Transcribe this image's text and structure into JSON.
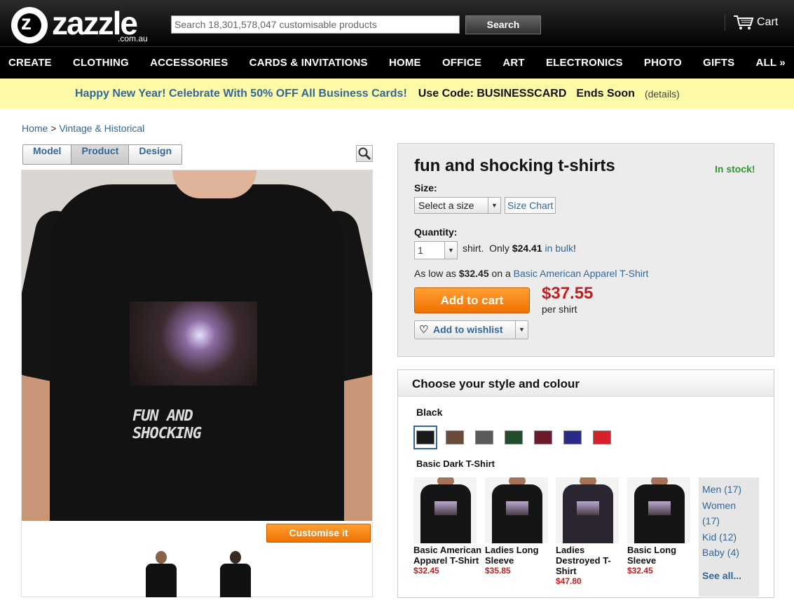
{
  "header": {
    "logo": "zazzle",
    "logo_sub": ".com.au",
    "search_placeholder": "Search 18,301,578,047 customisable products",
    "search_button": "Search",
    "cart_label": "Cart",
    "nav": [
      "CREATE",
      "CLOTHING",
      "ACCESSORIES",
      "CARDS & INVITATIONS",
      "HOME",
      "OFFICE",
      "ART",
      "ELECTRONICS",
      "PHOTO",
      "GIFTS",
      "ALL »"
    ]
  },
  "promo": {
    "headline": "Happy New Year! Celebrate With 50% OFF All Business Cards!",
    "code": "Use Code: BUSINESSCARD",
    "ends": "Ends Soon",
    "details": "(details)"
  },
  "breadcrumb": {
    "home": "Home",
    "separator": ">",
    "category": "Vintage & Historical"
  },
  "view_tabs": [
    "Model",
    "Product",
    "Design"
  ],
  "active_tab": "Product",
  "product_image": {
    "print_text": "FUN AND SHOCKING",
    "customise_button": "Customise it"
  },
  "buybox": {
    "title": "fun and shocking t-shirts",
    "stock": "In stock!",
    "size_label": "Size:",
    "size_select": "Select a size",
    "size_chart": "Size Chart",
    "quantity_label": "Quantity:",
    "quantity_value": "1",
    "qty_unit": "shirt.",
    "qty_only": "Only",
    "qty_bulk_price": "$24.41",
    "qty_bulk_link": "in bulk",
    "qty_bang": "!",
    "aslow_prefix": "As low as",
    "aslow_price": "$32.45",
    "aslow_on": "on a",
    "aslow_link": "Basic American Apparel T-Shirt",
    "add_to_cart": "Add to cart",
    "price": "$37.55",
    "per": "per shirt",
    "wishlist": "Add to wishlist"
  },
  "style": {
    "heading": "Choose your style and colour",
    "color_name": "Black",
    "swatches": [
      "#1a1a1a",
      "#6b4a3a",
      "#5a5a5a",
      "#234d2a",
      "#6a1a28",
      "#2a2a8a",
      "#d8202a"
    ],
    "style_name": "Basic Dark T-Shirt",
    "products": [
      {
        "name": "Basic American Apparel T-Shirt",
        "price": "$32.45"
      },
      {
        "name": "Ladies Long Sleeve",
        "price": "$35.85"
      },
      {
        "name": "Ladies Destroyed T-Shirt",
        "price": "$47.80"
      },
      {
        "name": "Basic Long Sleeve",
        "price": "$32.45"
      }
    ],
    "categories": [
      "Men (17)",
      "Women (17)",
      "Kid (12)",
      "Baby (4)"
    ],
    "see_all": "See all..."
  }
}
